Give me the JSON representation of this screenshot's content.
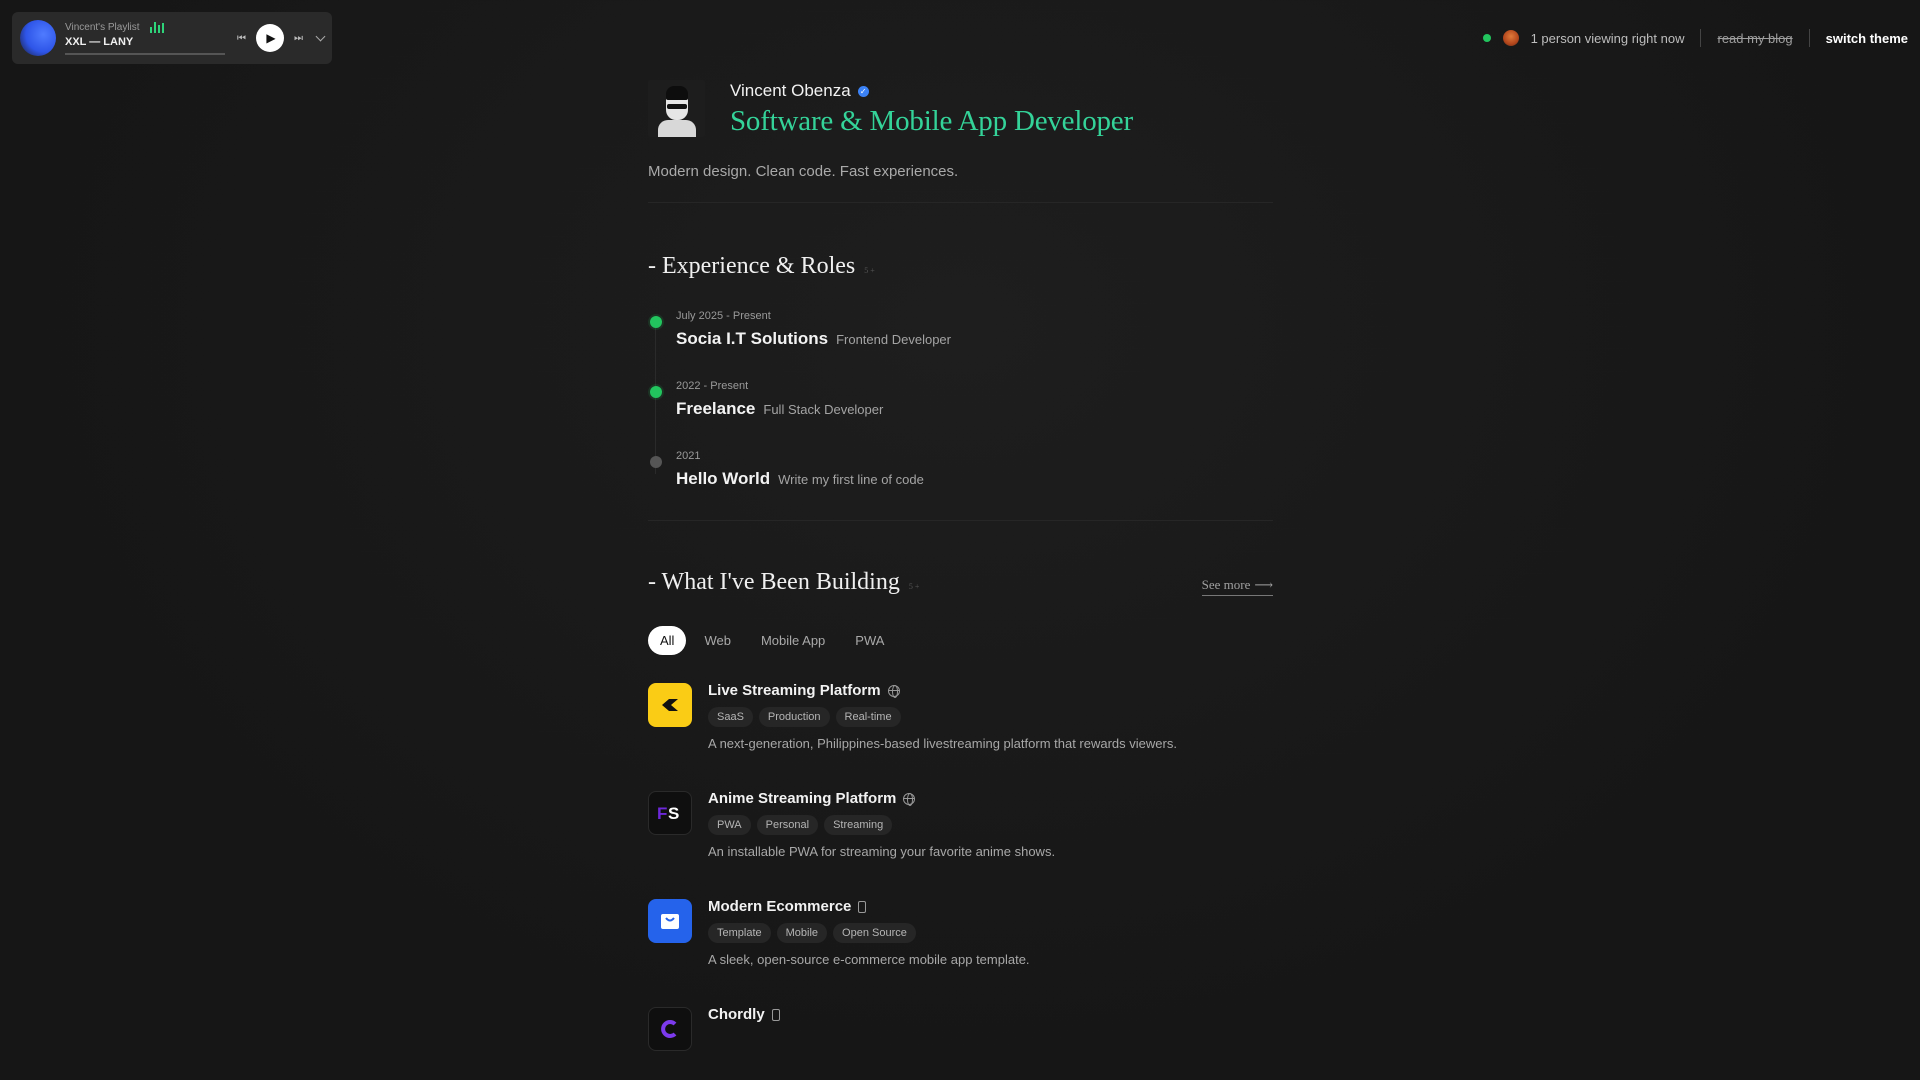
{
  "player": {
    "playlist": "Vincent's Playlist",
    "track": "XXL — LANY",
    "progress": 0.0,
    "prev_icon": "skip-back-icon",
    "play_icon": "play-icon",
    "next_icon": "skip-forward-icon",
    "expand_icon": "chevron-down-icon"
  },
  "header": {
    "viewers": "1 person viewing right now",
    "blog_link": "read my blog",
    "theme_button": "switch theme"
  },
  "profile": {
    "name": "Vincent Obenza",
    "headline": "Software & Mobile App Developer",
    "tagline": "Modern design. Clean code. Fast experiences."
  },
  "experience": {
    "title": "- Experience & Roles",
    "sub": "5 +",
    "items": [
      {
        "date": "July 2025 - Present",
        "company": "Socia I.T Solutions",
        "role": "Frontend Developer",
        "active": true
      },
      {
        "date": "2022 - Present",
        "company": "Freelance",
        "role": "Full Stack Developer",
        "active": true
      },
      {
        "date": "2021",
        "company": "Hello World",
        "role": "Write my first line of code",
        "active": false
      }
    ]
  },
  "projects": {
    "title": "- What I've Been Building",
    "sub": "5 +",
    "see_more": "See more",
    "filters": [
      "All",
      "Web",
      "Mobile App",
      "PWA"
    ],
    "active_filter": "All",
    "items": [
      {
        "title": "Live Streaming Platform",
        "type_icon": "globe-icon",
        "tags": [
          "SaaS",
          "Production",
          "Real-time"
        ],
        "desc": "A next-generation, Philippines-based livestreaming platform that rewards viewers.",
        "icon_color": "#facc15"
      },
      {
        "title": "Anime Streaming Platform",
        "type_icon": "globe-icon",
        "tags": [
          "PWA",
          "Personal",
          "Streaming"
        ],
        "desc": "An installable PWA for streaming your favorite anime shows.",
        "icon_color": "#0f0f0f"
      },
      {
        "title": "Modern Ecommerce",
        "type_icon": "phone-icon",
        "tags": [
          "Template",
          "Mobile",
          "Open Source"
        ],
        "desc": "A sleek, open-source e-commerce mobile app template.",
        "icon_color": "#2563eb"
      },
      {
        "title": "Chordly",
        "type_icon": "phone-icon",
        "tags": [],
        "desc": "",
        "icon_color": "#0f0f0f"
      }
    ]
  },
  "colors": {
    "accent": "#34d399",
    "live": "#22c55e",
    "verified": "#3b82f6"
  }
}
